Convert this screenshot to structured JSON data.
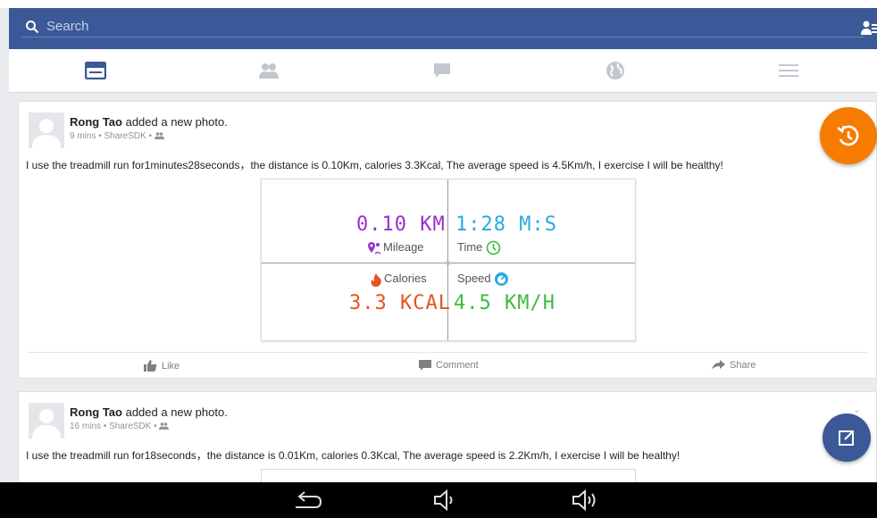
{
  "search": {
    "placeholder": "Search"
  },
  "tabs": [
    {
      "icon": "news-feed-icon",
      "active": true
    },
    {
      "icon": "friends-icon",
      "active": false
    },
    {
      "icon": "messages-icon",
      "active": false
    },
    {
      "icon": "globe-icon",
      "active": false
    },
    {
      "icon": "menu-icon",
      "active": false
    }
  ],
  "posts": [
    {
      "author": "Rong Tao",
      "action": " added a new photo.",
      "meta": "9 mins • ShareSDK •",
      "text": "I use the treadmill run for1minutes28seconds，the distance is 0.10Km, calories 3.3Kcal, The average speed is 4.5Km/h, I exercise I will be healthy!",
      "stats": {
        "mileage_value": "0.10 KM",
        "mileage_label": "Mileage",
        "time_value": "1:28 M:S",
        "time_label": "Time",
        "calories_label": "Calories",
        "calories_value": "3.3 KCAL",
        "speed_label": "Speed",
        "speed_value": "4.5 KM/H"
      },
      "actions": {
        "like": "Like",
        "comment": "Comment",
        "share": "Share"
      }
    },
    {
      "author": "Rong Tao",
      "action": " added a new photo.",
      "meta": "16 mins • ShareSDK •",
      "text": "I use the treadmill run for18seconds，the distance is 0.01Km, calories 0.3Kcal, The average speed is 2.2Km/h, I exercise I will be healthy!"
    }
  ],
  "colors": {
    "brand": "#3b5998",
    "fab_orange": "#f57c00",
    "mileage": "#9b30c8",
    "time": "#29a9e0",
    "calories": "#e8521e",
    "speed": "#3dbb3d"
  }
}
